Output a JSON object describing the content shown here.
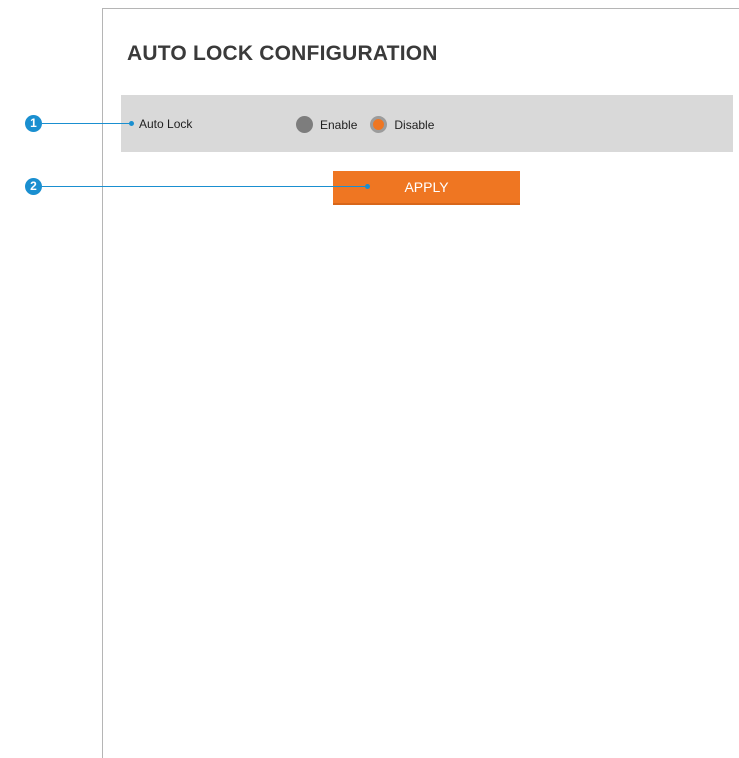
{
  "page": {
    "title": "AUTO LOCK CONFIGURATION"
  },
  "auto_lock": {
    "label": "Auto Lock",
    "options": [
      {
        "label": "Enable",
        "selected": false
      },
      {
        "label": "Disable",
        "selected": true
      }
    ]
  },
  "actions": {
    "apply_label": "APPLY"
  },
  "callouts": {
    "one": "1",
    "two": "2"
  },
  "colors": {
    "accent": "#ef7622",
    "callout": "#1a8fd0",
    "row_background": "#d9d9d9",
    "unselected_radio": "#7d7d7d"
  }
}
